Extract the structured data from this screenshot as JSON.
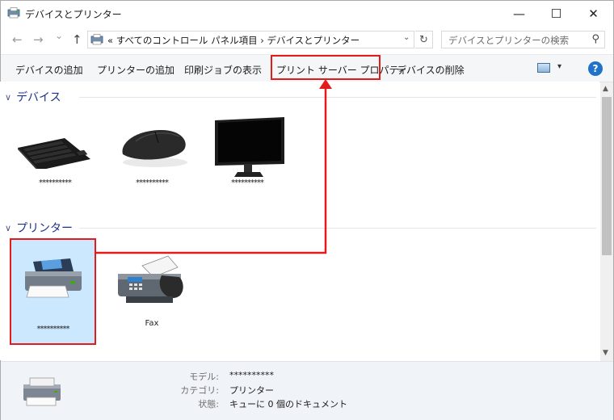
{
  "window": {
    "title": "デバイスとプリンター",
    "minimize_glyph": "—",
    "maximize_glyph": "☐",
    "close_glyph": "✕"
  },
  "nav": {
    "back_glyph": "←",
    "forward_glyph": "→",
    "recent_glyph": "⌄",
    "up_glyph": "↑",
    "address_path": "« すべてのコントロール パネル項目 › デバイスとプリンター",
    "dropdown_glyph": "⌄",
    "refresh_glyph": "↻",
    "search_placeholder": "デバイスとプリンターの検索",
    "search_glyph": "⚲"
  },
  "commands": {
    "add_device": "デバイスの追加",
    "add_printer": "プリンターの追加",
    "print_queue": "印刷ジョブの表示",
    "server_properties": "プリント サーバー プロパティ",
    "remove_device": "デバイスの削除",
    "view_dropdown_glyph": "▾",
    "help_glyph": "?"
  },
  "sections": {
    "devices": {
      "title": "デバイス",
      "items": [
        {
          "label": "**********",
          "icon": "keyboard-icon"
        },
        {
          "label": "**********",
          "icon": "mouse-icon"
        },
        {
          "label": "**********",
          "icon": "monitor-icon"
        }
      ]
    },
    "printers": {
      "title": "プリンター",
      "items": [
        {
          "label": "**********",
          "icon": "printer-icon",
          "selected": true
        },
        {
          "label": "Fax",
          "icon": "fax-icon"
        }
      ]
    },
    "chevron_glyph": "∨"
  },
  "scrollbar": {
    "up_glyph": "▲",
    "down_glyph": "▼"
  },
  "details": {
    "model_label": "モデル:",
    "model_value": "**********",
    "category_label": "カテゴリ:",
    "category_value": "プリンター",
    "status_label": "状態:",
    "status_value": "キューに 0 個のドキュメント"
  },
  "colors": {
    "highlight": "#e41b1b",
    "selection": "#cce8ff",
    "section_heading": "#1e3287"
  }
}
